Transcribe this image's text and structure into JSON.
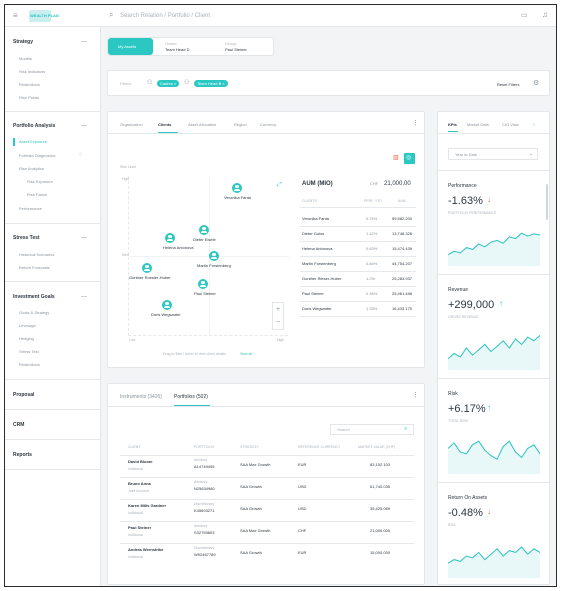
{
  "app": {
    "logo": "WEALTH PLAN"
  },
  "search": {
    "placeholder": "Search Relation / Portfolio / Client"
  },
  "sidebar": [
    {
      "title": "Strategy",
      "collapse": "—",
      "items": [
        "Models",
        "Risk Indicators",
        "Restrictions",
        "Rise Points"
      ]
    },
    {
      "title": "Portfolio Analysis",
      "collapse": "—",
      "items": [
        "Asset Exposure",
        "Portfolio Diagnostics",
        "Rise Analytics",
        "Risk Exposure",
        "Risk Factor",
        "Performance"
      ]
    },
    {
      "title": "Stress Test",
      "collapse": "—",
      "items": [
        "Historical Scenarios",
        "Return Forecasts"
      ]
    },
    {
      "title": "Investment Goals",
      "collapse": "—",
      "items": [
        "Goals & Strategy",
        "Leverage",
        "Hedging",
        "Stress Test",
        "Restrictions"
      ]
    },
    {
      "title": "Proposal"
    },
    {
      "title": "CRM"
    },
    {
      "title": "Reports"
    }
  ],
  "context": {
    "active": "My Assets",
    "owner_label": "Owner",
    "owner_value": "Team Head D",
    "group_label": "Group",
    "group_value": "Paul Steiner"
  },
  "filters": {
    "label": "Filters:",
    "chips": [
      "Cadres",
      "Team Head B"
    ],
    "reset": "Reset Filters"
  },
  "analysis": {
    "tabs": [
      "Organization",
      "Clients",
      "Asset Allocation",
      "Region",
      "Currency"
    ],
    "active_tab": 1,
    "scatter_hint": "Risk Level",
    "y_top": "High",
    "y_mid": "Med",
    "x_left": "Low",
    "x_right": "High",
    "footer_note": "Drag to filter / hover to view client details",
    "footer_link": "View all",
    "zoom_plus": "+",
    "zoom_minus": "−",
    "points": [
      {
        "name": "Veronika Fanta"
      },
      {
        "name": "Dieter Eisele"
      },
      {
        "name": "Helena Antonova"
      },
      {
        "name": "Martin Forstenberg"
      },
      {
        "name": "Gunther Roesler-Huber"
      },
      {
        "name": "Paul Steiner"
      },
      {
        "name": "Doris Wegwarter"
      }
    ],
    "aum_title": "AUM (MIO)",
    "aum_currency": "CHF",
    "aum_total": "21,000.00",
    "cols": [
      "CLIENTS",
      "PERF. YTD",
      "AUM"
    ],
    "rows": [
      [
        "Veronika Fanta",
        "0.75%",
        "59,582.200"
      ],
      [
        "Dieter Golos",
        "1.42%",
        "13,748.328"
      ],
      [
        "Helena Antonova",
        "0.63%",
        "15,474.439"
      ],
      [
        "Martin Forstenberg",
        "0.84%",
        "44,754.207"
      ],
      [
        "Gunther Rieser-Huber",
        "1.2%",
        "25,283.937"
      ],
      [
        "Paul Steiner",
        "0.45%",
        "25,461.498"
      ],
      [
        "Doris Wegwarter",
        "1.33%",
        "16,433.170"
      ]
    ]
  },
  "instruments": {
    "tabs": [
      "Instruments (3426)",
      "Portfolios (502)"
    ],
    "active_tab": 1,
    "search_placeholder": "Search",
    "cols": [
      "CLIENT",
      "PORTFOLIO",
      "STRATEGY",
      "REFERENCE CURRENCY",
      "MARKET VALUE (CHF)"
    ],
    "rows": [
      {
        "client": "David Bloom",
        "sub": "Individual",
        "pf": "Advisory",
        "pf_id": "A14749405",
        "strategy": "SAA Max Growth",
        "ccy": "EUR",
        "mv": "83,152.103"
      },
      {
        "client": "Bruno Anna",
        "sub": "Joint Account",
        "pf": "Advisory",
        "pf_id": "N25634980",
        "strategy": "SAA Growth",
        "ccy": "USD",
        "mv": "61,740.035"
      },
      {
        "client": "Karen Mills Gardner",
        "sub": "Individual",
        "pf": "Discretionary",
        "pf_id": "K45693271",
        "strategy": "SAA Growth",
        "ccy": "USD",
        "mv": "35,425.069"
      },
      {
        "client": "Paul Steiner",
        "sub": "Individual",
        "pf": "Advisory",
        "pf_id": "S32759803",
        "strategy": "SAA Max Growth",
        "ccy": "CHF",
        "mv": "21,000.000"
      },
      {
        "client": "Andrea Wernstrike",
        "sub": "Individual",
        "pf": "Discretionary",
        "pf_id": "W92467789",
        "strategy": "SAA Growth",
        "ccy": "EUR",
        "mv": "15,000.000"
      }
    ]
  },
  "kpi": {
    "tabs": [
      "KPIs",
      "Market Data",
      "CIO View"
    ],
    "active_tab": 0,
    "period": "Year to Date",
    "cards": [
      {
        "title": "Performance",
        "value": "-1.63%",
        "dir": "down",
        "sub": "PORTFOLIO PERFORMANCE",
        "color": "#e8603c",
        "trend": [
          0.2,
          0.3,
          0.25,
          0.4,
          0.35,
          0.5,
          0.42,
          0.55,
          0.6,
          0.52,
          0.7,
          0.65,
          0.8,
          0.72,
          0.78,
          0.75
        ]
      },
      {
        "title": "Revenue",
        "value": "+299,000",
        "dir": "up",
        "sub": "GROSS REVENUE",
        "color": "#29c4c0",
        "trend": [
          0.2,
          0.35,
          0.25,
          0.5,
          0.3,
          0.45,
          0.6,
          0.4,
          0.55,
          0.7,
          0.5,
          0.75,
          0.6,
          0.8,
          0.7,
          0.85
        ]
      },
      {
        "title": "Risk",
        "value": "+6.17%",
        "dir": "up",
        "sub": "TOTAL RISK",
        "color": "#29c4c0",
        "trend": [
          0.6,
          0.75,
          0.5,
          0.45,
          0.7,
          0.8,
          0.55,
          0.4,
          0.3,
          0.65,
          0.8,
          0.5,
          0.35,
          0.6,
          0.7,
          0.45
        ]
      },
      {
        "title": "Return On Assets",
        "value": "-0.48%",
        "dir": "down",
        "sub": "ROA",
        "color": "#e8603c",
        "trend": [
          0.3,
          0.4,
          0.35,
          0.5,
          0.45,
          0.6,
          0.4,
          0.55,
          0.7,
          0.5,
          0.65,
          0.6,
          0.75,
          0.55,
          0.7,
          0.6
        ]
      }
    ]
  }
}
